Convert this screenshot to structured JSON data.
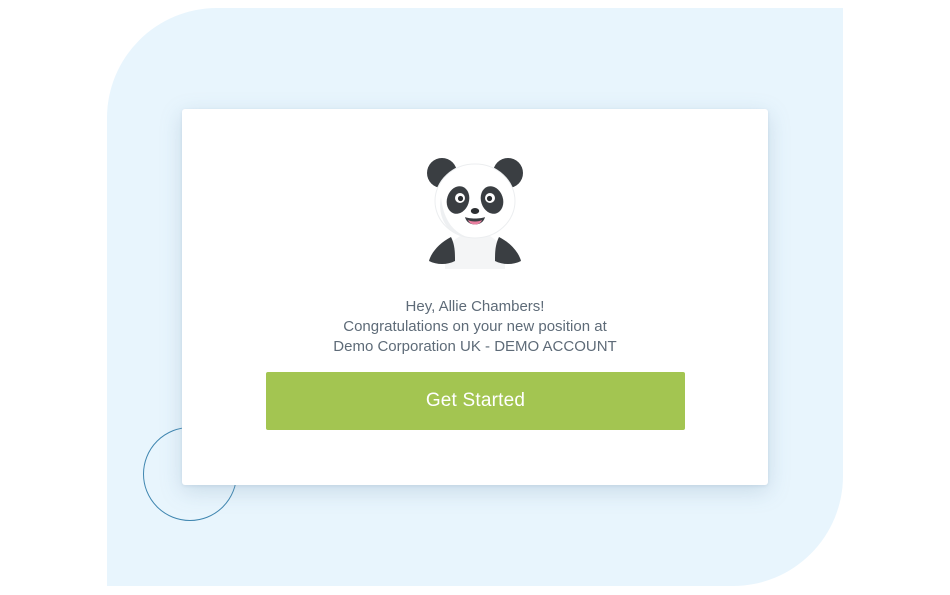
{
  "welcome": {
    "greeting": "Hey, Allie Chambers!",
    "line2": "Congratulations on your new position at",
    "line3": "Demo Corporation UK - DEMO ACCOUNT",
    "button_label": "Get Started",
    "avatar_icon": "panda-mascot-icon"
  },
  "colors": {
    "background_shape": "#e8f5fd",
    "button": "#a3c551",
    "text": "#5e6b78",
    "deco_circle": "#3f86b0"
  }
}
